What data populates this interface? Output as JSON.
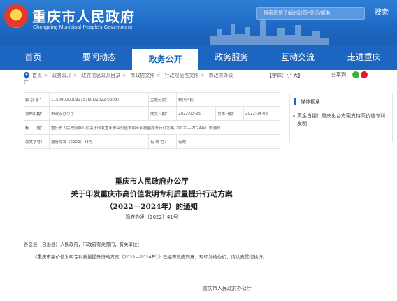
{
  "header": {
    "site_title": "重庆市人民政府",
    "site_subtitle": "Chongqing Municipal People's Government",
    "search_placeholder": "搜索您想了解的政策/资讯/服务",
    "search_button": "搜索"
  },
  "nav": {
    "items": [
      "首页",
      "要闻动态",
      "政务公开",
      "政务服务",
      "互动交流",
      "走进重庆"
    ],
    "active_index": 2
  },
  "breadcrumb": {
    "items": [
      "首页",
      "政务公开",
      "政府信息公开目录",
      "市政府文件",
      "行政规范性文件",
      "市政府办公"
    ],
    "wrap": "厅"
  },
  "font_size": "【字体：小 大】",
  "share_label": "分享到：",
  "info": {
    "index_label": "索 引 号：",
    "index_value": "11500000009275780L/2022-00037",
    "category_label": "主题分类：",
    "category_value": "知识产权",
    "issuer_label": "发布机构：",
    "issuer_value": "市政府办公厅",
    "created_label": "成文日期：",
    "created_value": "2022-03-25",
    "published_label": "发布日期：",
    "published_value": "2022-04-08",
    "name_label": "标　　题：",
    "name_value": "重庆市人民政府办公厅关于印发重庆市高价值发明专利质量提升行动方案（2022—2024年）的通知",
    "doc_no_label": "发文字号：",
    "doc_no_value": "渝府办发〔2022〕41号",
    "validity_label": "有 效 性：",
    "validity_value": "有效"
  },
  "side": {
    "title": "媒体视角",
    "item": "真金白银！重庆出台方案支持高价值专利发明"
  },
  "article": {
    "title_line1": "重庆市人民政府办公厅",
    "title_line2": "关于印发重庆市高价值发明专利质量提升行动方案",
    "title_line3": "（2022—2024年）的通知",
    "doc_no": "渝府办发〔2022〕41号",
    "salutation": "各区县（自治县）人民政府，市政府有关部门，有关单位：",
    "body": "《重庆市高价值发明专利质量提升行动方案（2022—2024年）》已经市政府同意，现印发给你们，请认真贯彻执行。",
    "signature": "重庆市人民政府办公厅"
  }
}
